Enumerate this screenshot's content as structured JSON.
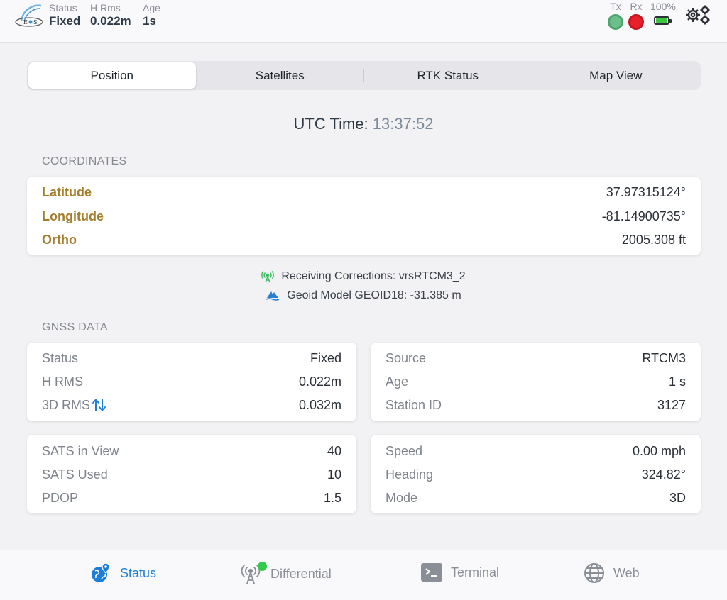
{
  "header": {
    "status": {
      "label": "Status",
      "value": "Fixed"
    },
    "h_rms": {
      "label": "H Rms",
      "value": "0.022m"
    },
    "age": {
      "label": "Age",
      "value": "1s"
    },
    "tx_label": "Tx",
    "rx_label": "Rx",
    "battery": {
      "label": "100%",
      "level": 1.0
    },
    "colors": {
      "tx": "#6dbf8a",
      "rx": "#e8202c",
      "battery": "#3ec43e"
    }
  },
  "tabs": [
    {
      "label": "Position",
      "active": true
    },
    {
      "label": "Satellites",
      "active": false
    },
    {
      "label": "RTK Status",
      "active": false
    },
    {
      "label": "Map View",
      "active": false
    }
  ],
  "utc": {
    "label": "UTC Time:",
    "time": "13:37:52"
  },
  "coordinates": {
    "section_label": "COORDINATES",
    "rows": [
      {
        "key": "Latitude",
        "value": "37.97315124°"
      },
      {
        "key": "Longitude",
        "value": "-81.14900735°"
      },
      {
        "key": "Ortho",
        "value": "2005.308 ft"
      }
    ]
  },
  "info": {
    "corrections": "Receiving Corrections: vrsRTCM3_2",
    "geoid": "Geoid Model GEOID18: -31.385 m"
  },
  "gnss": {
    "section_label": "GNSS DATA",
    "card1": [
      {
        "key": "Status",
        "value": "Fixed"
      },
      {
        "key": "H RMS",
        "value": "0.022m"
      },
      {
        "key": "3D RMS",
        "value": "0.032m"
      }
    ],
    "card2": [
      {
        "key": "Source",
        "value": "RTCM3"
      },
      {
        "key": "Age",
        "value": "1 s"
      },
      {
        "key": "Station ID",
        "value": "3127"
      }
    ],
    "card3": [
      {
        "key": "SATS in View",
        "value": "40"
      },
      {
        "key": "SATS Used",
        "value": "10"
      },
      {
        "key": "PDOP",
        "value": "1.5"
      }
    ],
    "card4": [
      {
        "key": "Speed",
        "value": "0.00 mph"
      },
      {
        "key": "Heading",
        "value": "324.82°"
      },
      {
        "key": "Mode",
        "value": "3D"
      }
    ]
  },
  "tabbar": [
    {
      "label": "Status",
      "icon": "globe-pin-icon",
      "active": true
    },
    {
      "label": "Differential",
      "icon": "antenna-icon",
      "active": false
    },
    {
      "label": "Terminal",
      "icon": "terminal-icon",
      "active": false
    },
    {
      "label": "Web",
      "icon": "web-globe-icon",
      "active": false
    }
  ],
  "accent_color": "#1c7ed6"
}
